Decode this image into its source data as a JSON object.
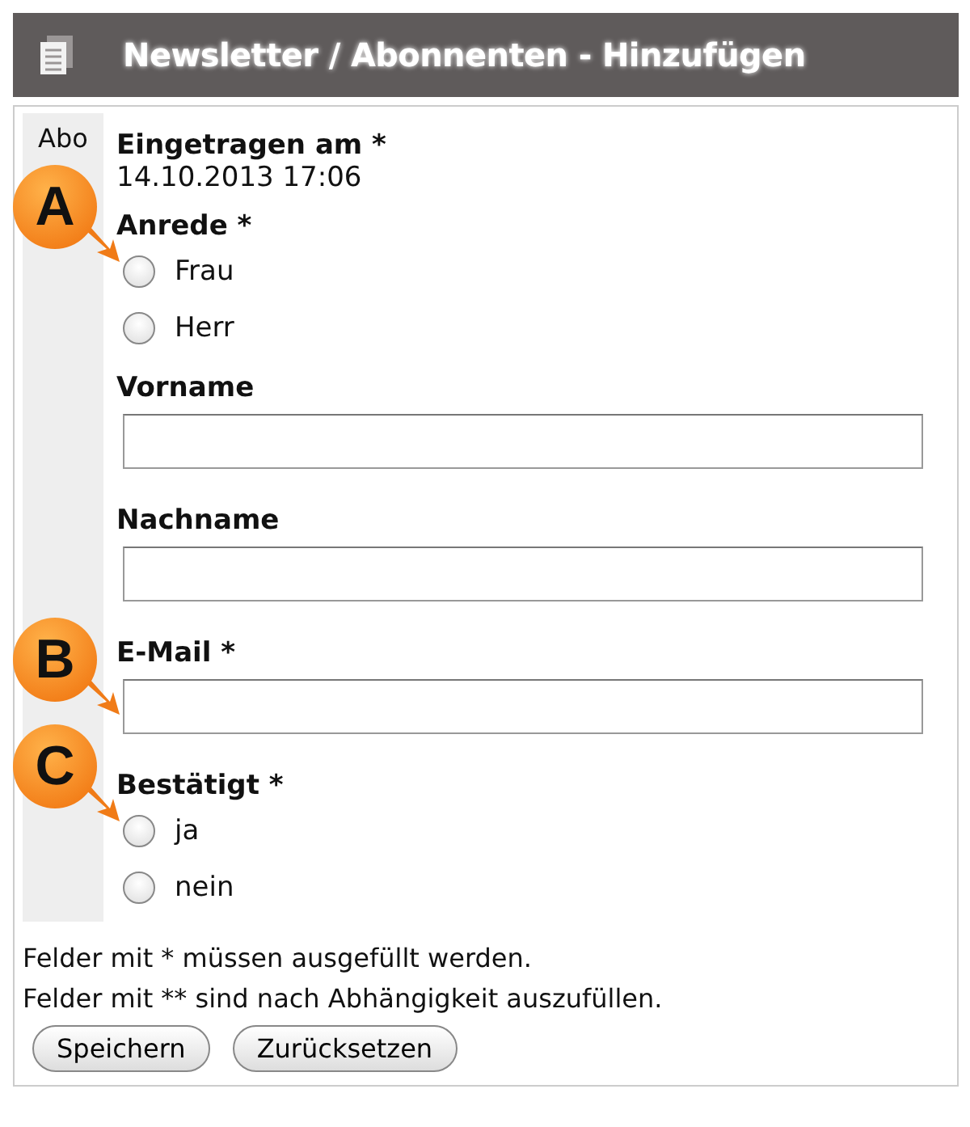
{
  "header": {
    "title": "Newsletter / Abonnenten - Hinzufügen"
  },
  "sidebar": {
    "label": "Abo"
  },
  "fields": [
    {
      "kind": "datetime",
      "label": "Eingetragen am *",
      "value": "14.10.2013 17:06"
    },
    {
      "kind": "radio",
      "label": "Anrede *",
      "callout": "A",
      "options": [
        {
          "label": "Frau",
          "selected": false
        },
        {
          "label": "Herr",
          "selected": false
        }
      ]
    },
    {
      "kind": "text",
      "label": "Vorname"
    },
    {
      "kind": "text",
      "label": "Nachname"
    },
    {
      "kind": "text",
      "label": "E-Mail *",
      "callout": "B"
    },
    {
      "kind": "radio",
      "label": "Bestätigt *",
      "callout": "C",
      "options": [
        {
          "label": "ja",
          "selected": false
        },
        {
          "label": "nein",
          "selected": false
        }
      ]
    }
  ],
  "notes": [
    "Felder mit * müssen ausgefüllt werden.",
    "Felder mit ** sind nach Abhängigkeit auszufüllen."
  ],
  "buttons": [
    "Speichern",
    "Zurücksetzen"
  ]
}
